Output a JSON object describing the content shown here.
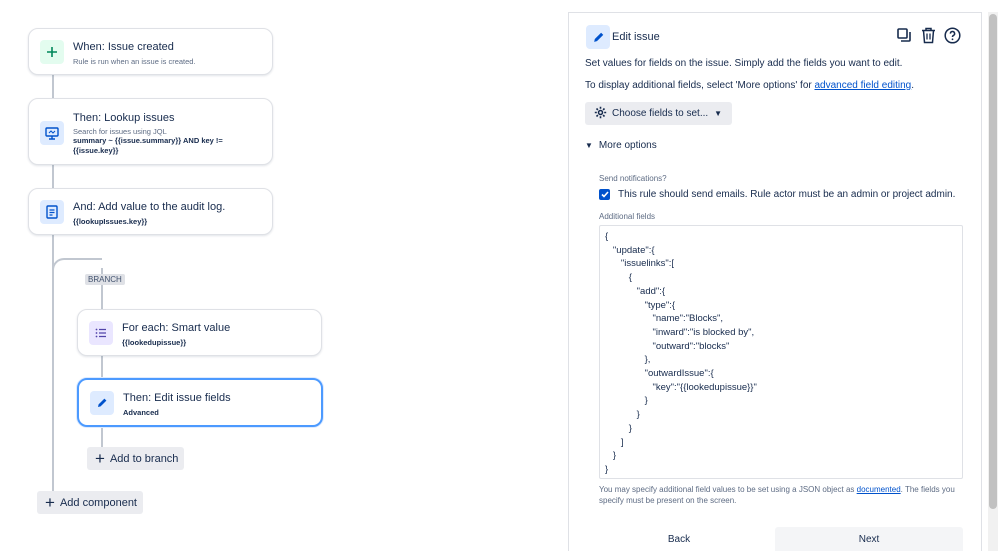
{
  "rule": {
    "trigger": {
      "title": "When: Issue created",
      "subtitle": "Rule is run when an issue is created."
    },
    "lookup": {
      "title": "Then: Lookup issues",
      "subtitle": "Search for issues using JQL",
      "jql": "summary ~ {{issue.summary}} AND key != {{issue.key}}"
    },
    "audit": {
      "title": "And: Add value to the audit log.",
      "subtitle": "{{lookupIssues.key}}"
    },
    "branch_label": "BRANCH",
    "foreach": {
      "title": "For each: Smart value",
      "subtitle": "{{lookedupissue}}"
    },
    "edit": {
      "title": "Then: Edit issue fields",
      "subtitle": "Advanced"
    },
    "add_to_branch": "Add to branch",
    "add_component": "Add component"
  },
  "panel": {
    "title": "Edit issue",
    "intro": "Set values for fields on the issue. Simply add the fields you want to edit.",
    "display_prefix": "To display additional fields, select 'More options' for ",
    "display_link": "advanced field editing",
    "display_suffix": ".",
    "choose_fields": "Choose fields to set...",
    "more_options": "More options",
    "send_notifications": "Send notifications?",
    "checkbox_label": "This rule should send emails. Rule actor must be an admin or project admin.",
    "additional_fields": "Additional fields",
    "json": "{\n   \"update\":{\n      \"issuelinks\":[\n         {\n            \"add\":{\n               \"type\":{\n                  \"name\":\"Blocks\",\n                  \"inward\":\"is blocked by\",\n                  \"outward\":\"blocks\"\n               },\n               \"outwardIssue\":{\n                  \"key\":\"{{lookedupissue}}\"\n               }\n            }\n         }\n      ]\n   }\n}",
    "help_prefix": "You may specify additional field values to be set using a JSON object as ",
    "help_link": "documented",
    "help_suffix": ". The fields you specify must be present on the screen.",
    "back": "Back",
    "next": "Next"
  },
  "colors": {
    "accent": "#0052cc",
    "selected_border": "#4c9aff",
    "trigger_green": "#00875a"
  }
}
